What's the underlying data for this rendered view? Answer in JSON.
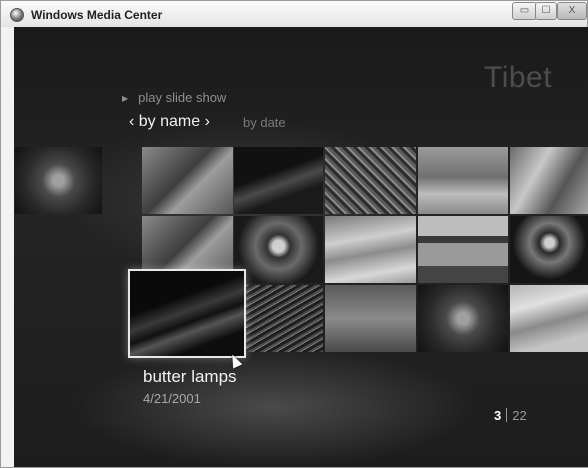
{
  "window": {
    "title": "Windows Media Center",
    "minimize_glyph": "▭",
    "maximize_glyph": "☐",
    "close_glyph": "X"
  },
  "folder": {
    "title": "Tibet"
  },
  "menu": {
    "play_slide_show": "play slide show",
    "play_icon": "triangle-right-icon",
    "sort_by_name": "‹ by name ›",
    "sort_by_date": "by date"
  },
  "selected_item": {
    "title": "butter lamps",
    "date": "4/21/2001"
  },
  "pager": {
    "current": "3",
    "total": "22"
  },
  "thumbnails": [
    "buddha-shrine",
    "butter-lamps",
    "prayer-wheel",
    "mountains",
    "stupa",
    "buddha-shrine",
    "demon-mask",
    "clouds",
    "monastery",
    "demon-mask",
    "butter-lamps",
    "carving",
    "clouds",
    "mandala",
    "glacier"
  ]
}
